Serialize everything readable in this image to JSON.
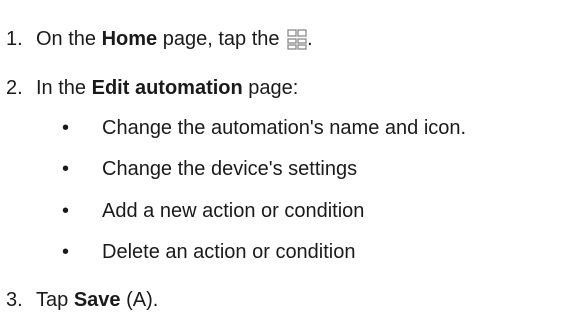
{
  "steps": [
    {
      "number": "1.",
      "prefix": "On the ",
      "bold": "Home",
      "middle": " page, tap the ",
      "icon": "grid-icon",
      "suffix": "."
    },
    {
      "number": "2.",
      "prefix": "In the ",
      "bold": "Edit automation",
      "suffix": " page:",
      "bullets": [
        "Change the automation's name and icon.",
        "Change the device's settings",
        "Add a new action or condition",
        "Delete an action or condition"
      ]
    },
    {
      "number": "3.",
      "prefix": "Tap ",
      "bold": "Save",
      "suffix": " (A)."
    }
  ],
  "bullet_char": "•"
}
